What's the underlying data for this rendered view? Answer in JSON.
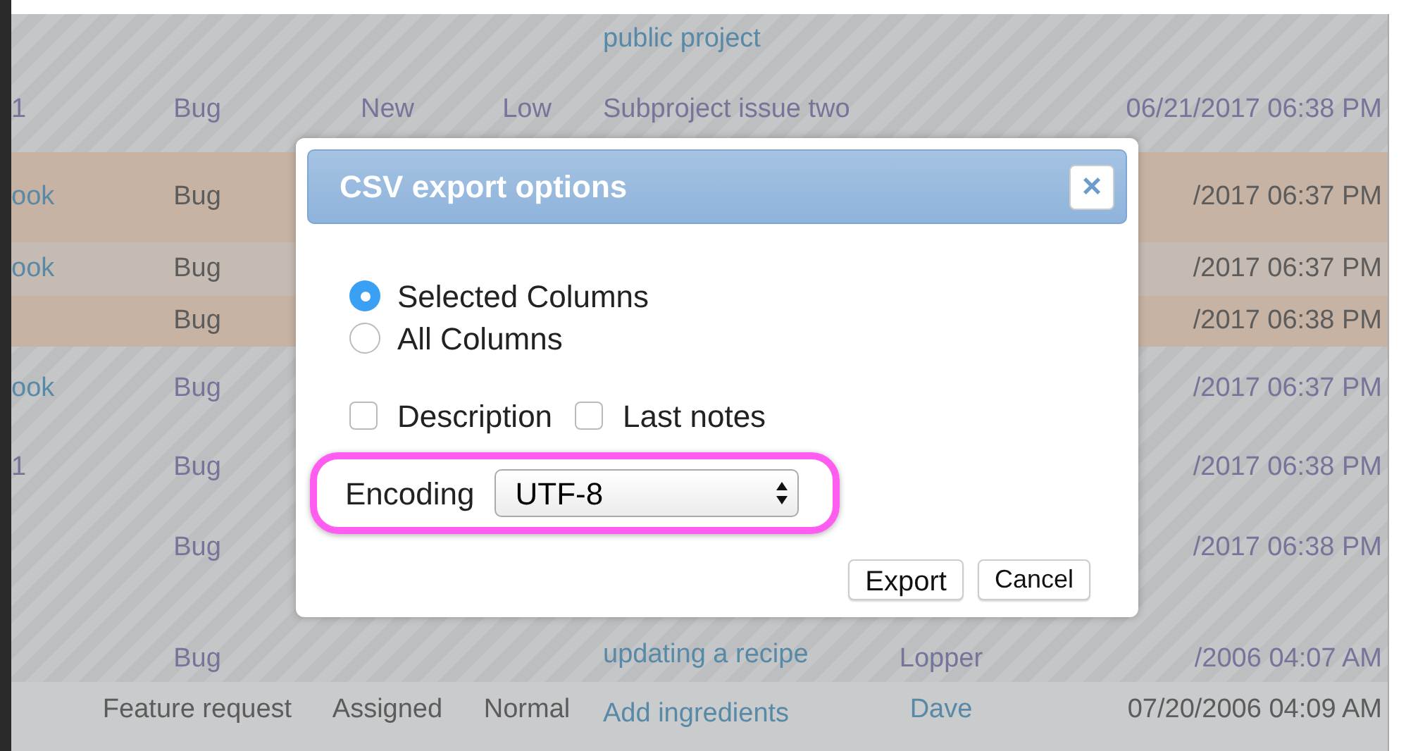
{
  "table": {
    "rows": [
      {
        "kind": "muted",
        "cells": {
          "subject": "public project"
        }
      },
      {
        "kind": "muted",
        "cells": {
          "project": "1",
          "tracker": "Bug",
          "status": "New",
          "priority": "Low",
          "subject": "Subproject issue two",
          "updated": "06/21/2017 06:38 PM"
        }
      },
      {
        "kind": "highlight",
        "cells": {
          "project": "ook",
          "tracker": "Bug",
          "updated": "/2017 06:37 PM"
        }
      },
      {
        "kind": "highlight-light",
        "cells": {
          "project": "ook",
          "tracker": "Bug",
          "updated": "/2017 06:37 PM"
        }
      },
      {
        "kind": "highlight",
        "cells": {
          "tracker": "Bug",
          "updated": "/2017 06:38 PM"
        }
      },
      {
        "kind": "muted",
        "cells": {
          "project": "ook",
          "tracker": "Bug",
          "updated": "/2017 06:37 PM"
        }
      },
      {
        "kind": "muted",
        "cells": {
          "project": "1",
          "tracker": "Bug",
          "updated": "/2017 06:38 PM"
        }
      },
      {
        "kind": "muted",
        "cells": {
          "tracker": "Bug",
          "updated": "/2017 06:38 PM"
        }
      },
      {
        "kind": "muted",
        "cells": {
          "tracker": "Bug",
          "subject": "updating a recipe",
          "assignee": "Lopper",
          "updated": "/2006 04:07 AM"
        }
      },
      {
        "kind": "plain",
        "cells": {
          "tracker": "Feature request",
          "status": "Assigned",
          "priority": "Normal",
          "subject": "Add ingredients",
          "assignee": "Dave",
          "updated": "07/20/2006 04:09 AM"
        }
      }
    ]
  },
  "dialog": {
    "title": "CSV export options",
    "close": "×",
    "radios": [
      {
        "label": "Selected Columns",
        "selected": true
      },
      {
        "label": "All Columns",
        "selected": false
      }
    ],
    "checkboxes": [
      {
        "label": "Description",
        "checked": false
      },
      {
        "label": "Last notes",
        "checked": false
      }
    ],
    "encoding": {
      "label": "Encoding",
      "value": "UTF-8",
      "highlighted": true
    },
    "buttons": [
      "Export",
      "Cancel"
    ]
  }
}
